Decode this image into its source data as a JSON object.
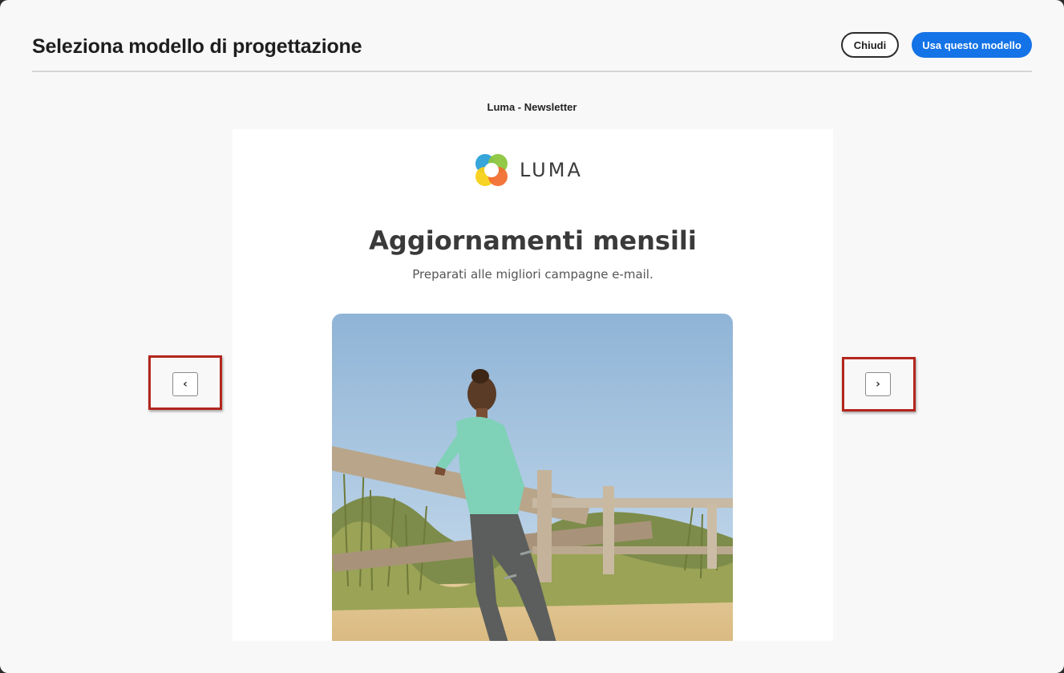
{
  "dialog": {
    "title": "Seleziona modello di progettazione",
    "close_label": "Chiudi",
    "use_label": "Usa questo modello",
    "accent_color": "#1473e6"
  },
  "preview": {
    "template_name": "Luma - Newsletter",
    "logo_text": "LUMA",
    "heading": "Aggiornamenti mensili",
    "subheading": "Preparati alle migliori campagne e-mail.",
    "hero_image": "woman leaning on wooden beach fence"
  },
  "navigation": {
    "previous_icon": "chevron-left-icon",
    "previous_glyph": "‹",
    "next_icon": "chevron-right-icon",
    "next_glyph": "›",
    "highlight_color": "#b3261e"
  }
}
